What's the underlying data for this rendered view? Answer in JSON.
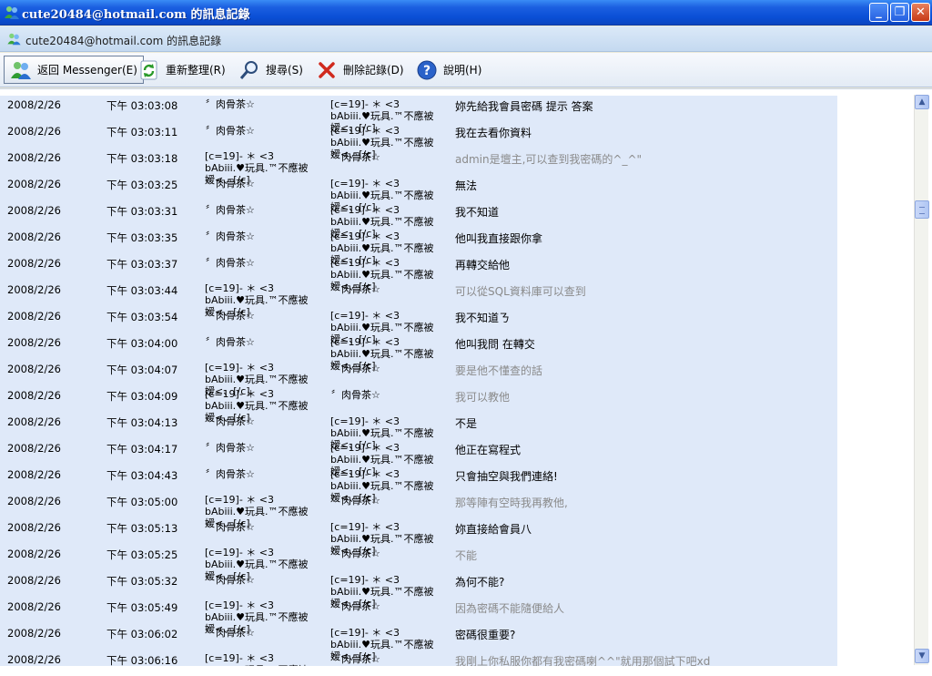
{
  "window": {
    "title": "cute20484@hotmail.com 的訊息記錄",
    "minimize": "_",
    "maximize": "❐",
    "close": "✕"
  },
  "header": {
    "text": "cute20484@hotmail.com 的訊息記錄"
  },
  "toolbar": {
    "back": "返回 Messenger(E)",
    "refresh": "重新整理(R)",
    "search": "搜尋(S)",
    "delete": "刪除記錄(D)",
    "help": "說明(H)"
  },
  "nicks": {
    "a": "〞肉骨茶☆",
    "b": "[c=19]- ＊ <3 bAbiii.♥玩具.™不應被嫒<、[/c]"
  },
  "rows": [
    {
      "date": "2008/2/26",
      "time": "下午 03:03:08",
      "from": "a",
      "to": "b",
      "msg": "妳先給我會員密碼 提示 答案",
      "gray": false
    },
    {
      "date": "2008/2/26",
      "time": "下午 03:03:11",
      "from": "a",
      "to": "b",
      "msg": "我在去看你資料",
      "gray": false
    },
    {
      "date": "2008/2/26",
      "time": "下午 03:03:18",
      "from": "b",
      "to": "a",
      "msg": "admin是壇主,可以查到我密碼的^_^\"",
      "gray": true
    },
    {
      "date": "2008/2/26",
      "time": "下午 03:03:25",
      "from": "a",
      "to": "b",
      "msg": "無法",
      "gray": false
    },
    {
      "date": "2008/2/26",
      "time": "下午 03:03:31",
      "from": "a",
      "to": "b",
      "msg": "我不知道",
      "gray": false
    },
    {
      "date": "2008/2/26",
      "time": "下午 03:03:35",
      "from": "a",
      "to": "b",
      "msg": "他叫我直接跟你拿",
      "gray": false
    },
    {
      "date": "2008/2/26",
      "time": "下午 03:03:37",
      "from": "a",
      "to": "b",
      "msg": "再轉交給他",
      "gray": false
    },
    {
      "date": "2008/2/26",
      "time": "下午 03:03:44",
      "from": "b",
      "to": "a",
      "msg": "可以從SQL資料庫可以查到",
      "gray": true
    },
    {
      "date": "2008/2/26",
      "time": "下午 03:03:54",
      "from": "a",
      "to": "b",
      "msg": "我不知道ㄋ",
      "gray": false
    },
    {
      "date": "2008/2/26",
      "time": "下午 03:04:00",
      "from": "a",
      "to": "b",
      "msg": "他叫我問 在轉交",
      "gray": false
    },
    {
      "date": "2008/2/26",
      "time": "下午 03:04:07",
      "from": "b",
      "to": "a",
      "msg": "要是他不懂查的話",
      "gray": true
    },
    {
      "date": "2008/2/26",
      "time": "下午 03:04:09",
      "from": "b",
      "to": "a",
      "msg": "我可以教他",
      "gray": true
    },
    {
      "date": "2008/2/26",
      "time": "下午 03:04:13",
      "from": "a",
      "to": "b",
      "msg": "不是",
      "gray": false
    },
    {
      "date": "2008/2/26",
      "time": "下午 03:04:17",
      "from": "a",
      "to": "b",
      "msg": "他正在寫程式",
      "gray": false
    },
    {
      "date": "2008/2/26",
      "time": "下午 03:04:43",
      "from": "a",
      "to": "b",
      "msg": "只會抽空與我們連絡!",
      "gray": false
    },
    {
      "date": "2008/2/26",
      "time": "下午 03:05:00",
      "from": "b",
      "to": "a",
      "msg": "那等陣有空時我再教他,",
      "gray": true
    },
    {
      "date": "2008/2/26",
      "time": "下午 03:05:13",
      "from": "a",
      "to": "b",
      "msg": "妳直接給會員八",
      "gray": false
    },
    {
      "date": "2008/2/26",
      "time": "下午 03:05:25",
      "from": "b",
      "to": "a",
      "msg": "不能",
      "gray": true
    },
    {
      "date": "2008/2/26",
      "time": "下午 03:05:32",
      "from": "a",
      "to": "b",
      "msg": "為何不能?",
      "gray": false
    },
    {
      "date": "2008/2/26",
      "time": "下午 03:05:49",
      "from": "b",
      "to": "a",
      "msg": "因為密碼不能隨便給人",
      "gray": true
    },
    {
      "date": "2008/2/26",
      "time": "下午 03:06:02",
      "from": "a",
      "to": "b",
      "msg": "密碼很重要?",
      "gray": false
    },
    {
      "date": "2008/2/26",
      "time": "下午 03:06:16",
      "from": "b",
      "to": "a",
      "msg": "我剛上你私服你都有我密碼喇^^\"就用那個試下吧xd",
      "gray": true
    }
  ],
  "scrollbar": {
    "up": "▲",
    "down": "▼"
  }
}
